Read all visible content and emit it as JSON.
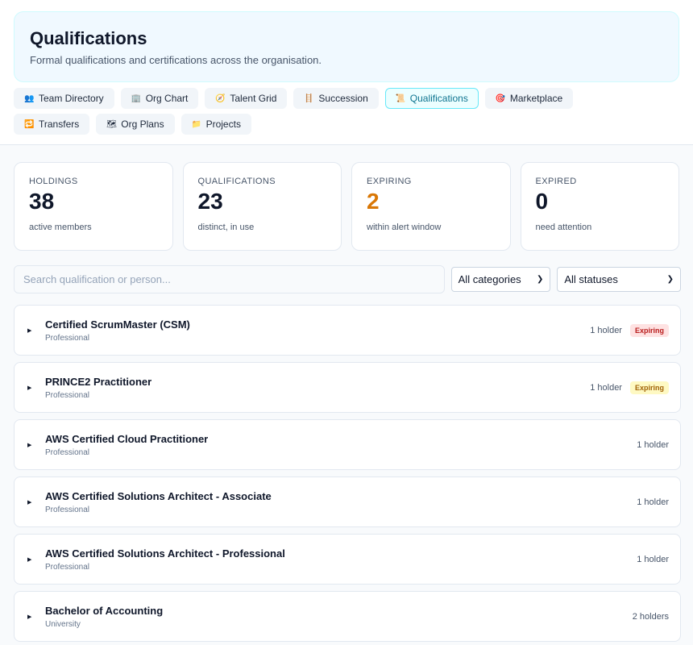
{
  "header": {
    "title": "Qualifications",
    "subtitle": "Formal qualifications and certifications across the organisation."
  },
  "tabs": [
    {
      "label": "Team Directory",
      "icon": "👥",
      "icon_name": "people-icon"
    },
    {
      "label": "Org Chart",
      "icon": "🏢",
      "icon_name": "building-icon"
    },
    {
      "label": "Talent Grid",
      "icon": "🧭",
      "icon_name": "compass-icon"
    },
    {
      "label": "Succession",
      "icon": "🪜",
      "icon_name": "ladder-icon"
    },
    {
      "label": "Qualifications",
      "icon": "📜",
      "icon_name": "scroll-icon",
      "active": true
    },
    {
      "label": "Marketplace",
      "icon": "🎯",
      "icon_name": "target-icon"
    },
    {
      "label": "Transfers",
      "icon": "🔁",
      "icon_name": "repeat-icon"
    },
    {
      "label": "Org Plans",
      "icon": "🗺",
      "icon_name": "map-icon"
    },
    {
      "label": "Projects",
      "icon": "📁",
      "icon_name": "folder-icon"
    }
  ],
  "stats": [
    {
      "label": "HOLDINGS",
      "value": "38",
      "sub": "active members"
    },
    {
      "label": "QUALIFICATIONS",
      "value": "23",
      "sub": "distinct, in use"
    },
    {
      "label": "EXPIRING",
      "value": "2",
      "sub": "within alert window",
      "color": "#d97706"
    },
    {
      "label": "EXPIRED",
      "value": "0",
      "sub": "need attention"
    }
  ],
  "filters": {
    "search_placeholder": "Search qualification or person...",
    "category_selected": "All categories",
    "status_selected": "All statuses"
  },
  "qualifications": [
    {
      "name": "Certified ScrumMaster (CSM)",
      "category": "Professional",
      "holders": "1 holder",
      "badge": "Expiring",
      "badge_color": "red"
    },
    {
      "name": "PRINCE2 Practitioner",
      "category": "Professional",
      "holders": "1 holder",
      "badge": "Expiring",
      "badge_color": "yellow"
    },
    {
      "name": "AWS Certified Cloud Practitioner",
      "category": "Professional",
      "holders": "1 holder"
    },
    {
      "name": "AWS Certified Solutions Architect - Associate",
      "category": "Professional",
      "holders": "1 holder"
    },
    {
      "name": "AWS Certified Solutions Architect - Professional",
      "category": "Professional",
      "holders": "1 holder"
    },
    {
      "name": "Bachelor of Accounting",
      "category": "University",
      "holders": "2 holders"
    }
  ]
}
